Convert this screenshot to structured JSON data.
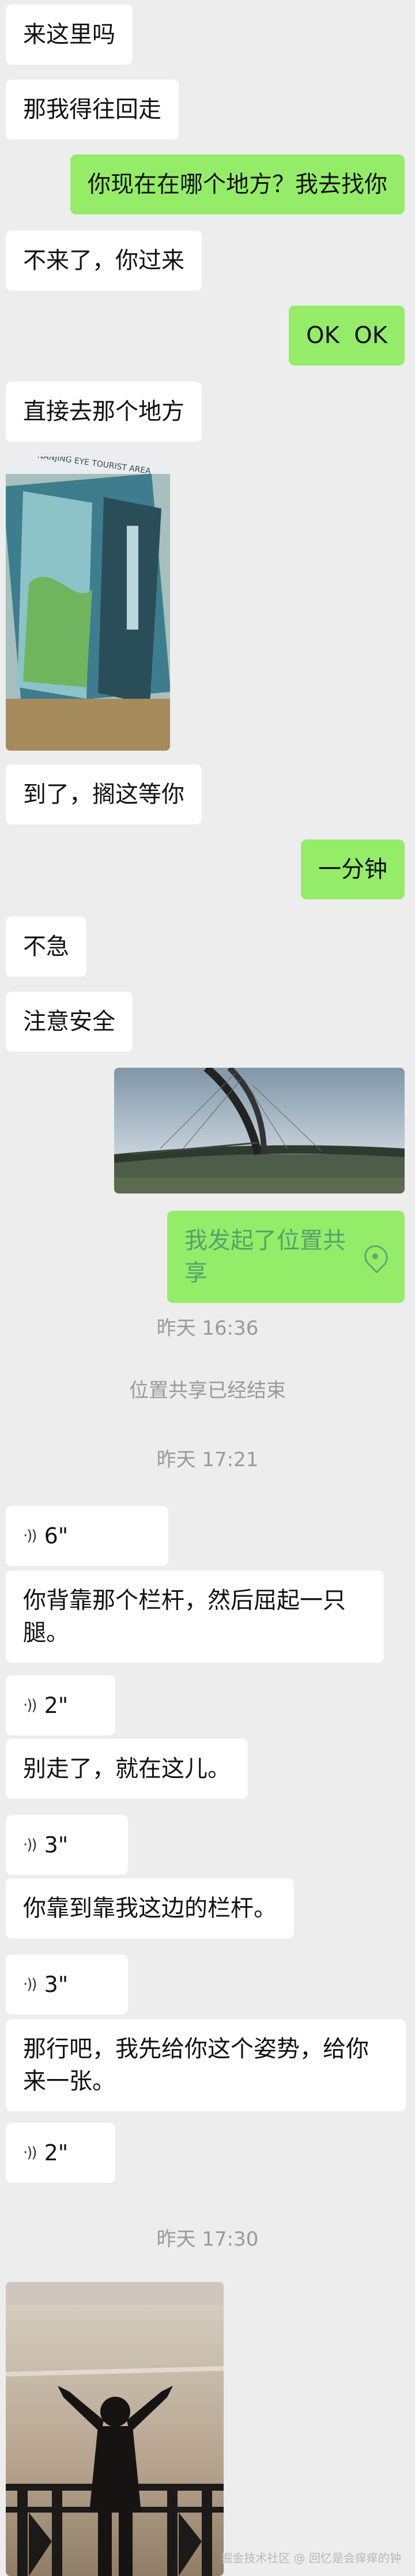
{
  "messages": {
    "m1": "来这里吗",
    "m2": "那我得往回走",
    "m3": "你现在在哪个地方？我去找你",
    "m4": "不来了，你过来",
    "m5": "OK  OK",
    "m6": "直接去那个地方",
    "m7": "到了，搁这等你",
    "m8": "一分钟",
    "m9": "不急",
    "m10": "注意安全",
    "m11_location_share": "我发起了位置共享",
    "m12": "你背靠那个栏杆，然后屈起一只腿。",
    "m13": "别走了，就在这儿。",
    "m14": "你靠到靠我这边的栏杆。",
    "m15": "那行吧，我先给你这个姿势，给你来一张。"
  },
  "system": {
    "time1": "昨天 16:36",
    "location_ended": "位置共享已经结束",
    "time2": "昨天 17:21",
    "time3": "昨天 17:30"
  },
  "voice": {
    "v1": "6\"",
    "v2": "2\"",
    "v3": "3\"",
    "v4": "3\"",
    "v5": "2\""
  },
  "photo_text": {
    "sign": "NANJING EYE TOURIST AREA"
  },
  "watermark": "掘金技术社区 @ 回忆是会痒痒的钟",
  "colors": {
    "background": "#ededed",
    "incoming_bubble": "#ffffff",
    "outgoing_bubble": "#95ec69",
    "timestamp": "#9a9a9a"
  },
  "icons": {
    "voice": "voice-wave-icon",
    "location": "location-pin-icon"
  }
}
